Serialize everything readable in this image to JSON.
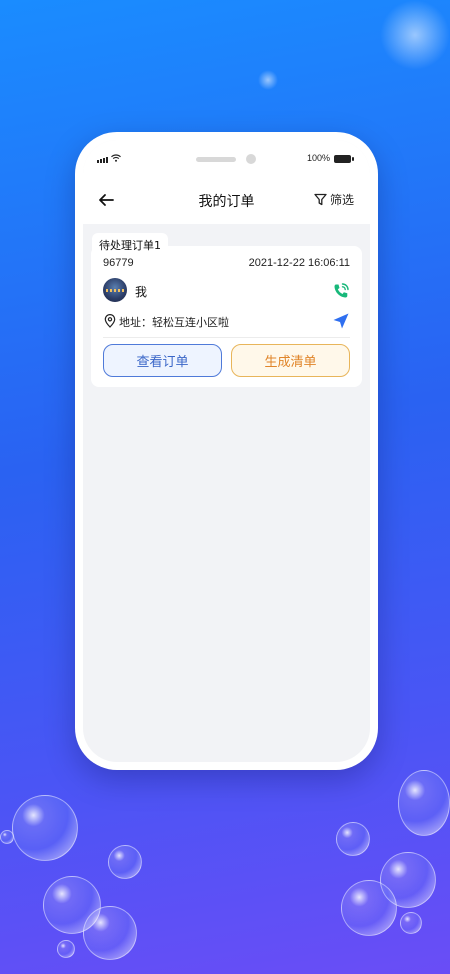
{
  "status_bar": {
    "battery_percent": "100%"
  },
  "header": {
    "title": "我的订单",
    "filter_label": "筛选"
  },
  "tabs": [
    {
      "label": "待处理订单1"
    }
  ],
  "orders": [
    {
      "order_no": "96779",
      "time": "2021-12-22 16:06:11",
      "customer": "我",
      "address": "地址：轻松互连小区啦",
      "actions": {
        "view_label": "查看订单",
        "generate_label": "生成清单"
      }
    }
  ],
  "colors": {
    "accent_blue": "#2f6ff0",
    "phone_green": "#18b87a",
    "orange": "#e0852a",
    "background_gradient_start": "#1a8cff",
    "background_gradient_end": "#6a4df6"
  },
  "icons": {
    "back": "arrow-left-icon",
    "filter": "funnel-icon",
    "call": "phone-call-icon",
    "location": "map-pin-icon",
    "navigate": "navigation-arrow-icon"
  }
}
